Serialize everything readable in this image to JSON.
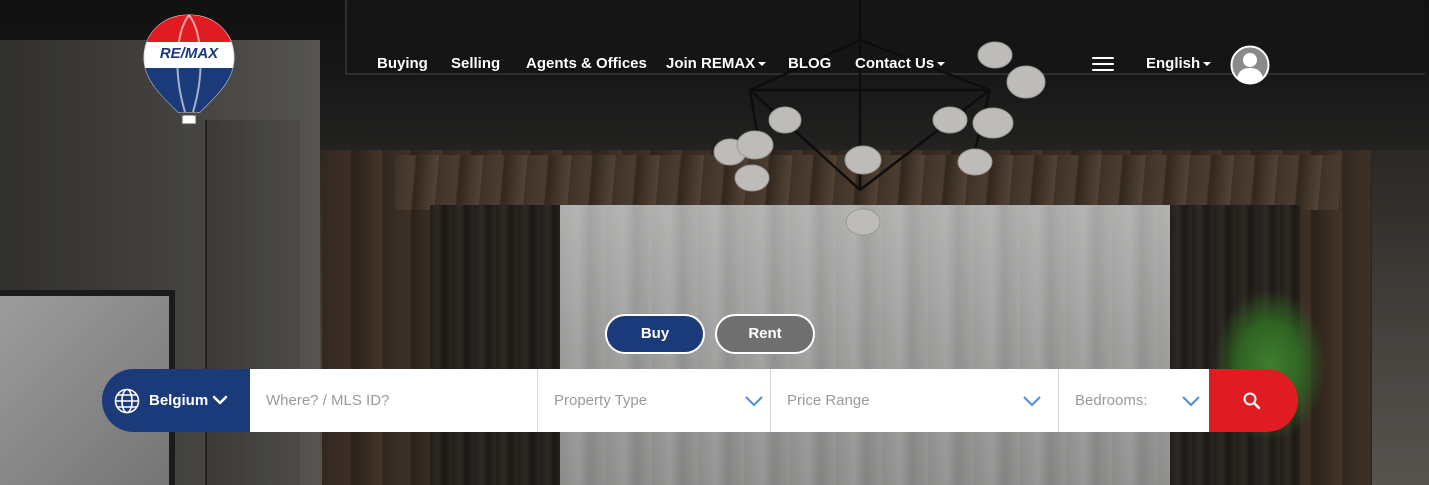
{
  "brand": {
    "logo_text": "RE/MAX",
    "colors": {
      "blue": "#1b3a7a",
      "red": "#e11b22",
      "white": "#ffffff"
    }
  },
  "nav": {
    "items": [
      {
        "label": "Buying"
      },
      {
        "label": "Selling"
      },
      {
        "label": "Agents & Offices"
      },
      {
        "label": "Join REMAX",
        "dropdown": true
      },
      {
        "label": "BLOG"
      },
      {
        "label": "Contact Us",
        "dropdown": true
      }
    ],
    "language": "English",
    "menu_icon": "hamburger-icon",
    "profile_icon": "user-avatar-icon"
  },
  "search": {
    "modes": {
      "buy": "Buy",
      "rent": "Rent",
      "active": "Buy"
    },
    "country": {
      "label": "Belgium",
      "icon": "globe-icon"
    },
    "location_placeholder": "Where? / MLS ID?",
    "property_type": "Property Type",
    "price_range": "Price Range",
    "bedrooms": "Bedrooms:",
    "submit_icon": "search-icon"
  }
}
